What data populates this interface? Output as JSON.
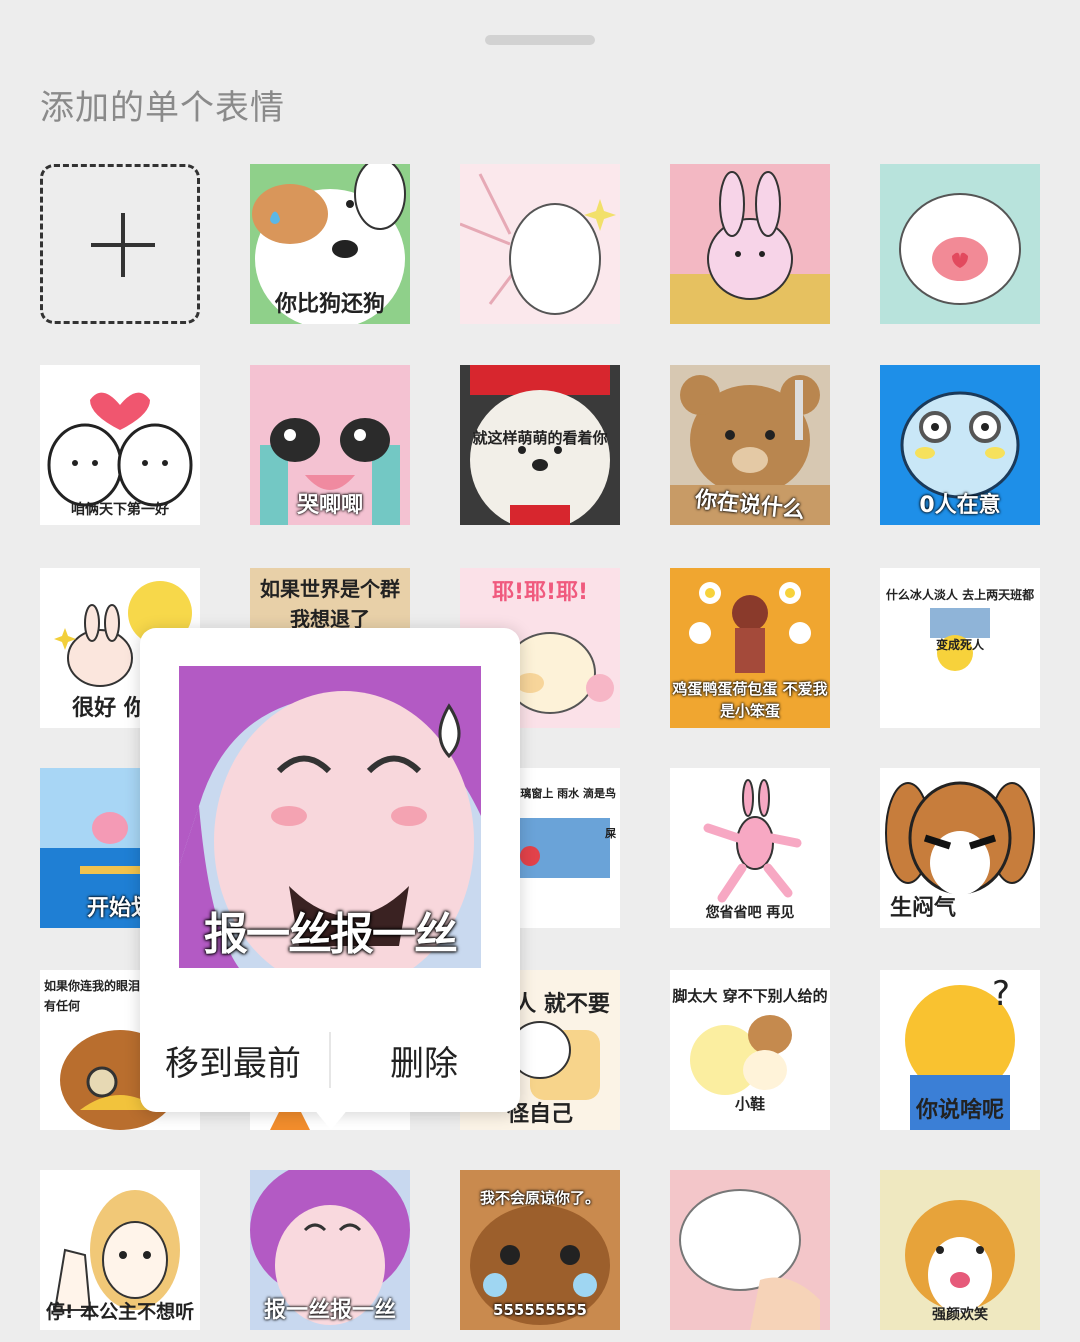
{
  "section_title": "添加的单个表情",
  "add_icon": "plus-icon",
  "stickers": [
    {
      "caption": "你比狗还狗",
      "bg": "#f2d9b0"
    },
    {
      "caption": "",
      "bg": "#fbe8ec"
    },
    {
      "caption": "",
      "bg": "#f3c5cf"
    },
    {
      "caption": "",
      "bg": "#bfe6df"
    },
    {
      "caption": "咱俩天下第一好",
      "bg": "#ffffff"
    },
    {
      "caption": "哭唧唧",
      "bg": "#f7c9d8"
    },
    {
      "caption": "就这样萌萌的看着你",
      "bg": "#e9e6df"
    },
    {
      "caption": "你在说什么",
      "bg": "#b9895a"
    },
    {
      "caption": "0人在意",
      "bg": "#2196f3"
    },
    {
      "caption": "很好 你真",
      "bg": "#ffffff"
    },
    {
      "caption": "如果世界是个群 我想退了",
      "bg": "#f4e6cf"
    },
    {
      "caption": "耶!耶!耶!",
      "bg": "#fce0e6"
    },
    {
      "caption": "鸡蛋鸭蛋荷包蛋 不爱我是小笨蛋",
      "bg": "#f0a830"
    },
    {
      "caption": "什么冰人淡人 去上两天班都变成死人",
      "bg": "#ffffff"
    },
    {
      "caption": "开始划",
      "bg": "#4aa8e8"
    },
    {
      "caption": "",
      "bg": "#ffffff"
    },
    {
      "caption": "是我生命玻璃窗上 雨水 滴是鸟屎",
      "bg": "#ffffff"
    },
    {
      "caption": "您省省吧 再见",
      "bg": "#ffffff"
    },
    {
      "caption": "生闷气",
      "bg": "#ffffff"
    },
    {
      "caption": "如果你连我的眼泪 那我也没有任何",
      "bg": "#ffffff"
    },
    {
      "caption": "",
      "bg": "#ffffff"
    },
    {
      "caption": "怪别人 就不要怪自己",
      "bg": "#fbf3e6"
    },
    {
      "caption": "脚太大 穿不下别人给的小鞋",
      "bg": "#ffffff"
    },
    {
      "caption": "你说啥呢",
      "bg": "#ffffff"
    },
    {
      "caption": "停! 本公主不想听",
      "bg": "#ffffff"
    },
    {
      "caption": "报一丝报一丝",
      "bg": "#c8d8ef"
    },
    {
      "caption": "我不会原谅你了。 555555555",
      "bg": "#c98a4e"
    },
    {
      "caption": "",
      "bg": "#f3c6c9"
    },
    {
      "caption": "强颜欢笑",
      "bg": "#efe8c0"
    }
  ],
  "popover": {
    "preview_caption": "报一丝报一丝",
    "move_to_front": "移到最前",
    "delete": "删除"
  }
}
